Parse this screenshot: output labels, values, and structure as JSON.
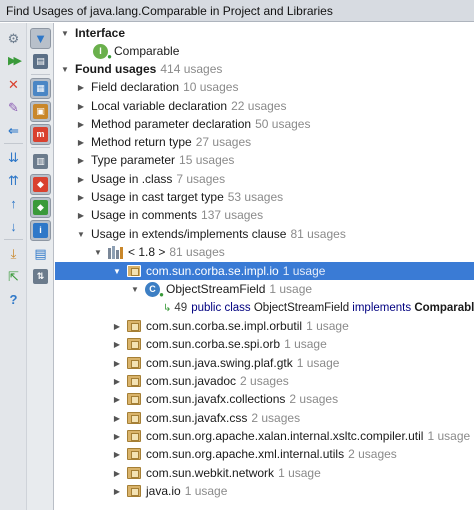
{
  "window": {
    "title": "Find Usages of java.lang.Comparable in Project and Libraries"
  },
  "toolbar": {
    "col1": [
      {
        "name": "rerun-icon",
        "glyph": "⚙"
      },
      {
        "name": "expand-all-icon",
        "glyph": "▸▸"
      },
      {
        "name": "close-icon",
        "glyph": "✕"
      },
      {
        "name": "pin-icon",
        "glyph": "✎"
      },
      {
        "name": "previous-occurrence-icon",
        "glyph": "⇐"
      },
      {
        "name": "expand-icon",
        "glyph": "⇊"
      },
      {
        "name": "collapse-icon",
        "glyph": "⇈"
      },
      {
        "name": "up-arrow-icon",
        "glyph": "↑"
      },
      {
        "name": "down-arrow-icon",
        "glyph": "↓"
      },
      {
        "name": "export-icon",
        "glyph": "⤓"
      },
      {
        "name": "open-in-new-tab-icon",
        "glyph": "⇱"
      },
      {
        "name": "help-icon",
        "glyph": "?"
      }
    ],
    "col2": [
      {
        "name": "filter-icon",
        "glyph": "▼"
      },
      {
        "name": "group-by-usage-type-icon",
        "glyph": "▤"
      },
      {
        "name": "group-by-module-icon",
        "glyph": "▦"
      },
      {
        "name": "group-by-package-icon",
        "glyph": "▣"
      },
      {
        "name": "merge-usages-icon",
        "glyph": "m"
      },
      {
        "name": "show-read-access-icon",
        "glyph": "▥"
      },
      {
        "name": "show-write-access-icon",
        "glyph": "◆"
      },
      {
        "name": "show-imports-icon",
        "glyph": "◆"
      },
      {
        "name": "info-icon",
        "glyph": "i"
      },
      {
        "name": "preview-icon",
        "glyph": "▤"
      },
      {
        "name": "sort-icon",
        "glyph": "⇅"
      }
    ]
  },
  "tree": {
    "interface_header": "Interface",
    "interface_name": "Comparable",
    "found_label": "Found usages",
    "found_count": "414 usages",
    "groups": [
      {
        "label": "Field declaration",
        "count": "10 usages"
      },
      {
        "label": "Local variable declaration",
        "count": "22 usages"
      },
      {
        "label": "Method parameter declaration",
        "count": "50 usages"
      },
      {
        "label": "Method return type",
        "count": "27 usages"
      },
      {
        "label": "Type parameter",
        "count": "15 usages"
      },
      {
        "label": "Usage in .class",
        "count": "7 usages"
      },
      {
        "label": "Usage in cast target type",
        "count": "53 usages"
      },
      {
        "label": "Usage in comments",
        "count": "137 usages"
      },
      {
        "label": "Usage in extends/implements clause",
        "count": "81 usages"
      }
    ],
    "library": {
      "label": "< 1.8 >",
      "count": "81 usages"
    },
    "selected_package": {
      "label": "com.sun.corba.se.impl.io",
      "count": "1 usage"
    },
    "class_node": {
      "label": "ObjectStreamField",
      "count": "1 usage"
    },
    "code_line": {
      "line": "49",
      "kw1": "public",
      "kw2": "class",
      "name": "ObjectStreamField",
      "kw3": "implements",
      "target": "Comparable"
    },
    "packages": [
      {
        "label": "com.sun.corba.se.impl.orbutil",
        "count": "1 usage"
      },
      {
        "label": "com.sun.corba.se.spi.orb",
        "count": "1 usage"
      },
      {
        "label": "com.sun.java.swing.plaf.gtk",
        "count": "1 usage"
      },
      {
        "label": "com.sun.javadoc",
        "count": "2 usages"
      },
      {
        "label": "com.sun.javafx.collections",
        "count": "2 usages"
      },
      {
        "label": "com.sun.javafx.css",
        "count": "2 usages"
      },
      {
        "label": "com.sun.org.apache.xalan.internal.xsltc.compiler.util",
        "count": "1 usage"
      },
      {
        "label": "com.sun.org.apache.xml.internal.utils",
        "count": "2 usages"
      },
      {
        "label": "com.sun.webkit.network",
        "count": "1 usage"
      },
      {
        "label": "java.io",
        "count": "1 usage"
      }
    ]
  },
  "colors": {
    "selection": "#3a7bd5",
    "count_gray": "#8a8a8a",
    "keyword": "#000080"
  }
}
